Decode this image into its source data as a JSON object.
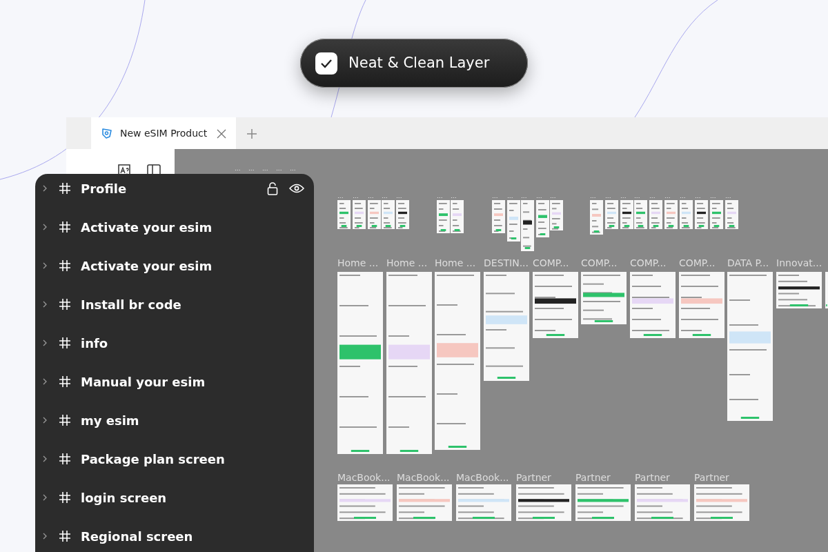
{
  "badge": {
    "label": "Neat & Clean Layer",
    "checked": true
  },
  "tabs": [
    {
      "title": "New eSIM Product",
      "selected": true
    }
  ],
  "canvas": {
    "top_labels": [
      "...",
      "...",
      "...",
      "...",
      "..."
    ],
    "mobile_frames": [
      {
        "label": "..."
      },
      {
        "label": "..."
      },
      {
        "label": "..."
      },
      {
        "label": "..."
      },
      {
        "label": "..."
      },
      {
        "label": "..."
      },
      {
        "label": "..."
      },
      {
        "label": "..."
      },
      {
        "label": "..."
      },
      {
        "label": "..."
      },
      {
        "label": "..."
      },
      {
        "label": "..."
      },
      {
        "label": "..."
      },
      {
        "label": "..."
      },
      {
        "label": "..."
      },
      {
        "label": "..."
      },
      {
        "label": "..."
      },
      {
        "label": "..."
      },
      {
        "label": "..."
      },
      {
        "label": "..."
      },
      {
        "label": "..."
      },
      {
        "label": "..."
      }
    ],
    "desktop_frames": [
      {
        "label": "Home ..."
      },
      {
        "label": "Home ..."
      },
      {
        "label": "Home ..."
      },
      {
        "label": "DESTIN..."
      },
      {
        "label": "COMP..."
      },
      {
        "label": "COMP..."
      },
      {
        "label": "COMP..."
      },
      {
        "label": "COMP..."
      },
      {
        "label": "DATA P..."
      },
      {
        "label": "Innovat..."
      }
    ],
    "dashboard_frames": [
      {
        "label": "MacBook..."
      },
      {
        "label": "MacBook..."
      },
      {
        "label": "MacBook..."
      },
      {
        "label": "Partner"
      },
      {
        "label": "Partner"
      },
      {
        "label": "Partner"
      },
      {
        "label": "Partner"
      }
    ]
  },
  "layers": [
    {
      "name": "Profile",
      "hovered": true
    },
    {
      "name": "Activate your esim",
      "hovered": false
    },
    {
      "name": "Activate your esim",
      "hovered": false
    },
    {
      "name": "Install br code",
      "hovered": false
    },
    {
      "name": "info",
      "hovered": false
    },
    {
      "name": "Manual your esim",
      "hovered": false
    },
    {
      "name": "my esim",
      "hovered": false
    },
    {
      "name": "Package plan screen",
      "hovered": false
    },
    {
      "name": "login screen",
      "hovered": false
    },
    {
      "name": "Regional screen",
      "hovered": false
    }
  ]
}
